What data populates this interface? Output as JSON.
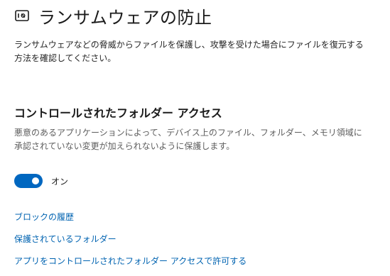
{
  "page": {
    "title": "ランサムウェアの防止",
    "icon": "protected-folder-icon",
    "description": "ランサムウェアなどの脅威からファイルを保護し、攻撃を受けた場合にファイルを復元する方法を確認してください。"
  },
  "controlled_folder_access": {
    "title": "コントロールされたフォルダー アクセス",
    "description": "悪意のあるアプリケーションによって、デバイス上のファイル、フォルダー、メモリ領域に承認されていない変更が加えられないように保護します。",
    "toggle": {
      "state": "on",
      "label": "オン",
      "accent_color": "#0067c0"
    }
  },
  "links": {
    "block_history": "ブロックの履歴",
    "protected_folders": "保護されているフォルダー",
    "allow_app": "アプリをコントロールされたフォルダー アクセスで許可する"
  }
}
